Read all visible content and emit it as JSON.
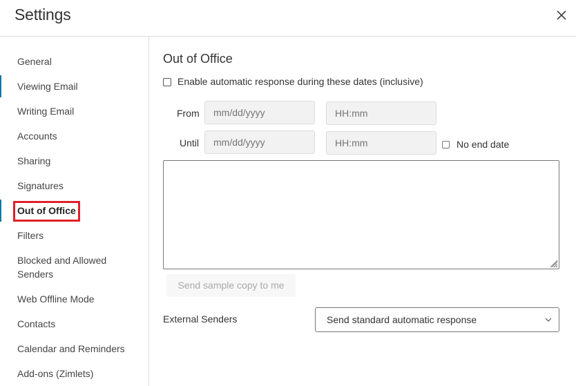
{
  "header": {
    "title": "Settings",
    "close_icon": "close-icon"
  },
  "sidebar": {
    "items": [
      {
        "label": "General"
      },
      {
        "label": "Viewing Email"
      },
      {
        "label": "Writing Email"
      },
      {
        "label": "Accounts"
      },
      {
        "label": "Sharing"
      },
      {
        "label": "Signatures"
      },
      {
        "label": "Out of Office",
        "active": true
      },
      {
        "label": "Filters"
      },
      {
        "label": "Blocked and Allowed Senders"
      },
      {
        "label": "Web Offline Mode"
      },
      {
        "label": "Contacts"
      },
      {
        "label": "Calendar and Reminders"
      },
      {
        "label": "Add-ons (Zimlets)"
      }
    ],
    "accent_color": "#0e7aa6",
    "highlight_color": "#e0202a"
  },
  "main": {
    "section_title": "Out of Office",
    "enable_checkbox": {
      "label": "Enable automatic response during these dates (inclusive)",
      "checked": false
    },
    "from": {
      "label": "From",
      "date_placeholder": "mm/dd/yyyy",
      "time_placeholder": "HH:mm",
      "date_value": "",
      "time_value": ""
    },
    "until": {
      "label": "Until",
      "date_placeholder": "mm/dd/yyyy",
      "time_placeholder": "HH:mm",
      "date_value": "",
      "time_value": ""
    },
    "no_end_date": {
      "label": "No end date",
      "checked": false
    },
    "message": "",
    "send_sample_label": "Send sample copy to me",
    "external_senders": {
      "label": "External Senders",
      "selected": "Send standard automatic response"
    }
  }
}
